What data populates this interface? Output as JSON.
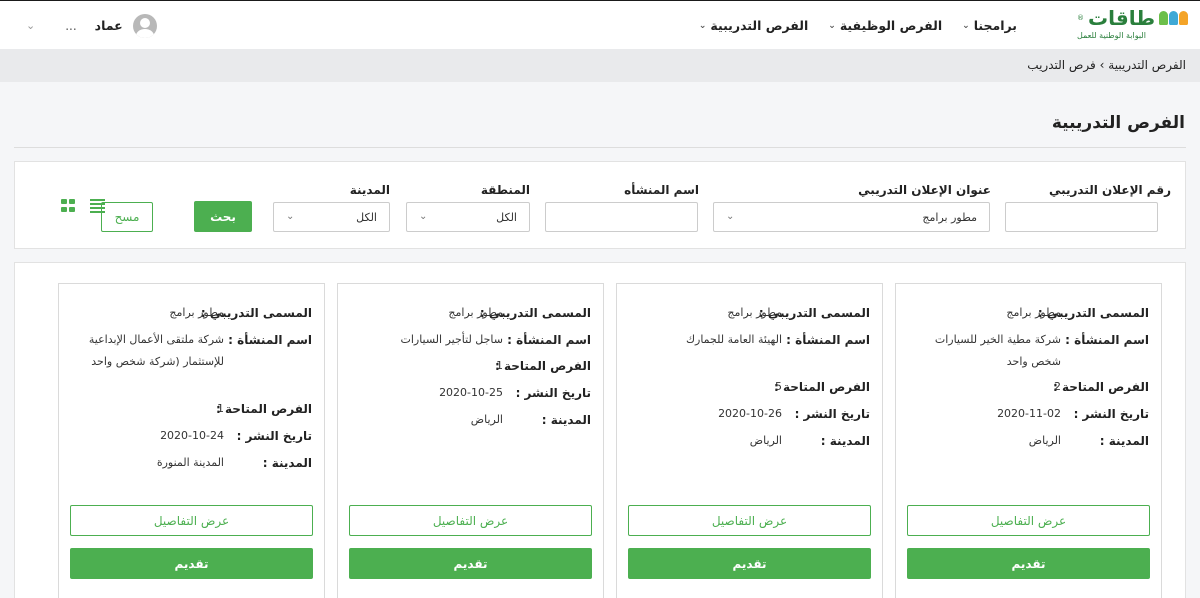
{
  "brand": {
    "logo_text": "طاقات",
    "logo_sub": "البوابة الوطنية للعمل",
    "registered_mark": "®"
  },
  "nav": {
    "items": [
      {
        "label": "برامجنا"
      },
      {
        "label": "الفرص الوظيفية"
      },
      {
        "label": "الفرص التدريبية"
      }
    ]
  },
  "user": {
    "name": "عماد",
    "more": "..."
  },
  "breadcrumb": {
    "parent": "الفرص التدريبية",
    "separator": "›",
    "current": "فرص التدريب"
  },
  "page": {
    "title": "الفرص التدريبية"
  },
  "search": {
    "ad_number_label": "رقم الإعلان التدريبي",
    "ad_number_value": "",
    "ad_title_label": "عنوان الإعلان التدريبي",
    "ad_title_value": "مطور برامج",
    "establishment_label": "اسم المنشأه",
    "establishment_value": "",
    "region_label": "المنطقة",
    "region_value": "الكل",
    "city_label": "المدينة",
    "city_value": "الكل",
    "search_button": "بحث",
    "clear_button": "مسح"
  },
  "labels": {
    "title": "المسمى التدريبي :",
    "establishment": "اسم المنشأة :",
    "available": "الفرص المتاحة :",
    "published": "تاريخ النشر :",
    "city": "المدينة :",
    "details_button": "عرض التفاصيل",
    "apply_button": "تقديم"
  },
  "cards": [
    {
      "title": "مطور برامج",
      "establishment": "شركة مطية الخير للسيارات شخص واحد",
      "available": "2",
      "published": "2020-11-02",
      "city": "الرياض"
    },
    {
      "title": "مطور برامج",
      "establishment": "الهيئة العامة للجمارك",
      "available": "5",
      "published": "2020-10-26",
      "city": "الرياض"
    },
    {
      "title": "مطور برامج",
      "establishment": "ساجل لتأجير السيارات",
      "available": "1",
      "published": "2020-10-25",
      "city": "الرياض"
    },
    {
      "title": "مطور برامج",
      "establishment": "شركة ملتقى الأعمال الإبداعية للإستثمار (شركة شخص واحد",
      "available": "1",
      "published": "2020-10-24",
      "city": "المدينة المنورة"
    }
  ],
  "colors": {
    "accent": "#4caf50",
    "brand_green": "#2a7f3c"
  }
}
